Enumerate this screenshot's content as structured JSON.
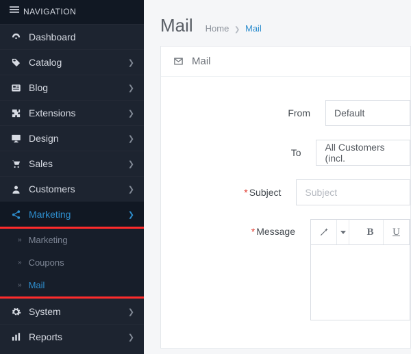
{
  "nav": {
    "header": "NAVIGATION",
    "items": {
      "dashboard": "Dashboard",
      "catalog": "Catalog",
      "blog": "Blog",
      "extensions": "Extensions",
      "design": "Design",
      "sales": "Sales",
      "customers": "Customers",
      "marketing": "Marketing",
      "system": "System",
      "reports": "Reports"
    },
    "sub": {
      "marketing": "Marketing",
      "coupons": "Coupons",
      "mail": "Mail"
    }
  },
  "page": {
    "title": "Mail",
    "breadcrumb": {
      "home": "Home",
      "current": "Mail"
    }
  },
  "panel": {
    "title": "Mail",
    "fields": {
      "from_label": "From",
      "from_value": "Default",
      "to_label": "To",
      "to_value": "All Customers (incl.",
      "subject_label": "Subject",
      "subject_placeholder": "Subject",
      "message_label": "Message"
    },
    "toolbar": {
      "bold": "B",
      "underline": "U"
    }
  }
}
